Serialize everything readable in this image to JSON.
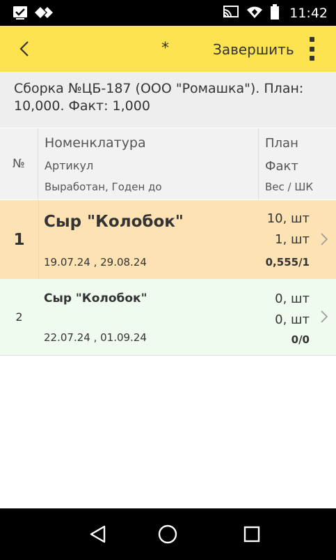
{
  "status_bar": {
    "time": "11:42",
    "left_icons": [
      "checkbox-icon",
      "diamond-arrows-icon"
    ],
    "right_icons": [
      "cast-icon",
      "wifi-icon",
      "battery-icon"
    ]
  },
  "app_bar": {
    "title": "*",
    "finish_label": "Завершить",
    "background_color": "#fce34f"
  },
  "document": {
    "summary": "Сборка №ЦБ-187 (ООО \"Ромашка\"). План: 10,000. Факт: 1,000"
  },
  "columns": {
    "number": "№",
    "name": "Номенклатура",
    "article": "Артикул",
    "dates": "Выработан, Годен до",
    "plan": "План",
    "fact": "Факт",
    "weight_barcode": "Вес / ШК"
  },
  "rows": [
    {
      "number": "1",
      "name": "Сыр \"Колобок\"",
      "dates": "19.07.24 , 29.08.24",
      "plan": "10, шт",
      "fact": "1, шт",
      "weight": "0,555/1",
      "background_color": "#fde2b3"
    },
    {
      "number": "2",
      "name": "Сыр \"Колобок\"",
      "dates": "22.07.24 , 01.09.24",
      "plan": "0, шт",
      "fact": "0, шт",
      "weight": "0/0",
      "background_color": "#f0fbf0"
    }
  ],
  "nav_bar": {
    "buttons": [
      "back-triangle-icon",
      "home-circle-icon",
      "recent-square-icon"
    ]
  }
}
